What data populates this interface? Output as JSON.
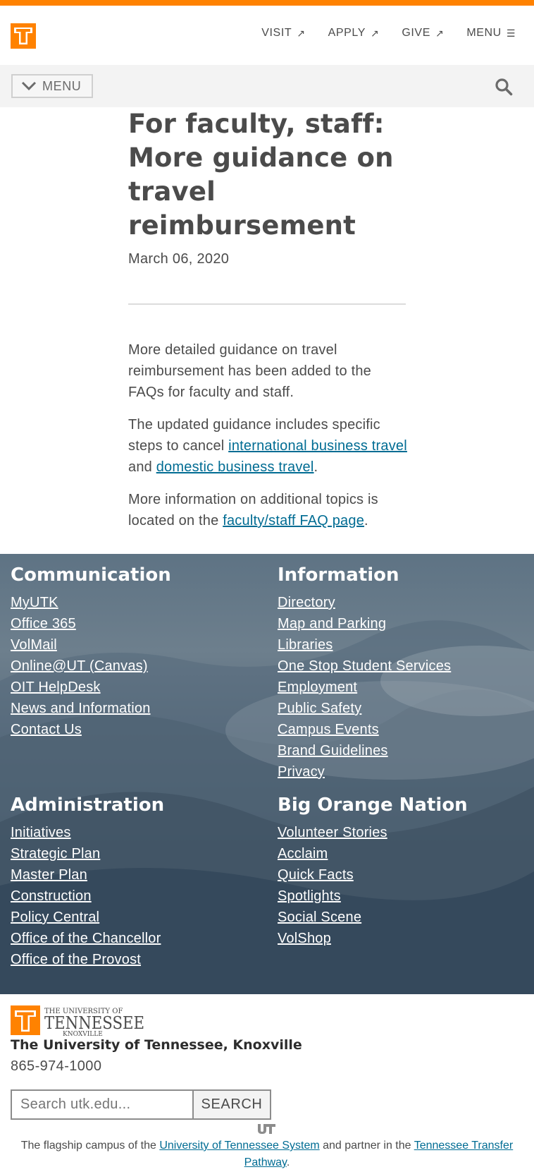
{
  "header": {
    "nav": [
      {
        "label": "VISIT",
        "suffix": "↗"
      },
      {
        "label": "APPLY",
        "suffix": "↗"
      },
      {
        "label": "GIVE",
        "suffix": "↗"
      },
      {
        "label": "MENU",
        "suffix": "☰"
      }
    ],
    "brand_color": "#ff8200"
  },
  "subnav": {
    "menu_label": "MENU",
    "icons": [
      "chevron-down-icon",
      "search-icon"
    ]
  },
  "article": {
    "title": "For faculty, staff: More guidance on travel reimbursement",
    "date": "March 06, 2020",
    "p1": "More detailed guidance on travel reimbursement has been added to the FAQs for faculty and staff.",
    "p2_pre": "The updated guidance includes specific steps to cancel ",
    "p2_link1": "international business travel",
    "p2_mid": " and ",
    "p2_link2": "domestic business travel",
    "p2_post": ".",
    "p3_pre": "More information on additional topics is located on the ",
    "p3_link": "faculty/staff FAQ page",
    "p3_post": "."
  },
  "footer": {
    "communication": {
      "heading": "Communication",
      "links": [
        "MyUTK",
        "Office 365",
        "VolMail",
        "Online@UT (Canvas)",
        "OIT HelpDesk",
        "News and Information",
        "Contact Us"
      ]
    },
    "information": {
      "heading": "Information",
      "links": [
        "Directory",
        "Map and Parking",
        "Libraries",
        "One Stop Student Services",
        "Employment",
        "Public Safety",
        "Campus Events",
        "Brand Guidelines",
        "Privacy"
      ]
    },
    "administration": {
      "heading": "Administration",
      "links": [
        "Initiatives",
        "Strategic Plan",
        "Master Plan",
        "Construction",
        "Policy Central",
        "Office of the Chancellor",
        "Office of the Provost"
      ]
    },
    "big_orange_nation": {
      "heading": "Big Orange Nation",
      "links": [
        "Volunteer Stories",
        "Acclaim",
        "Quick Facts",
        "Spotlights",
        "Social Scene",
        "VolShop"
      ]
    }
  },
  "bottom": {
    "logo_lines": [
      "THE UNIVERSITY OF",
      "TENNESSEE",
      "KNOXVILLE"
    ],
    "name": "The University of Tennessee, Knoxville",
    "phone": "865-974-1000",
    "search_placeholder": "Search utk.edu...",
    "search_button": "SEARCH",
    "flagship_pre": "The flagship campus of the ",
    "flagship_link1": "University of Tennessee System",
    "flagship_mid": " and partner in the ",
    "flagship_link2": "Tennessee Transfer Pathway",
    "flagship_post": "."
  }
}
